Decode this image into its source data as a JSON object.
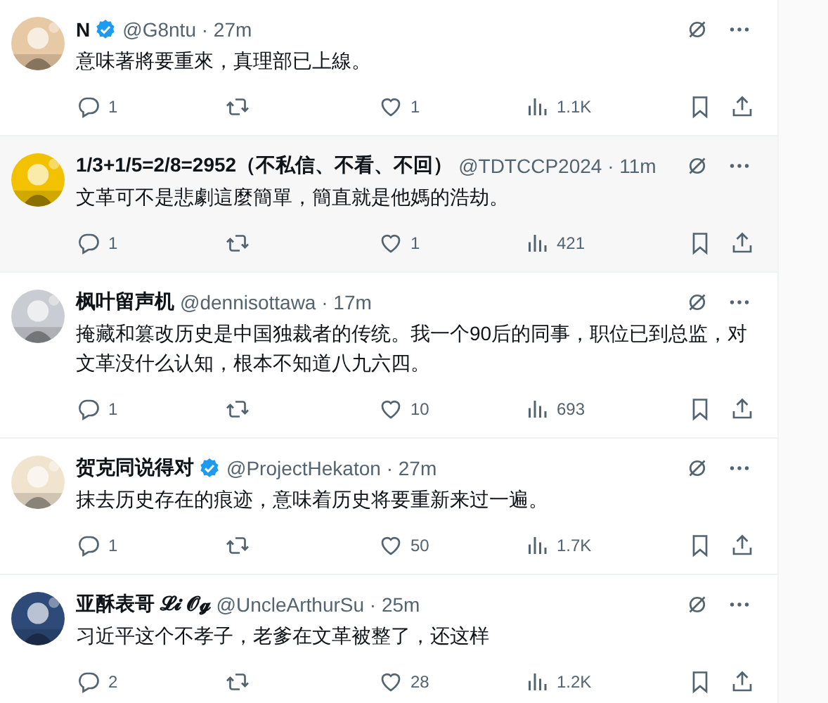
{
  "tweets": [
    {
      "name": "N",
      "verified": true,
      "meta": "@G8ntu · 27m",
      "text": "意味著將要重來，真理部已上線。",
      "highlighted": false,
      "replies": "1",
      "likes": "1",
      "views": "1.1K"
    },
    {
      "name": "1/3+1/5=2/8=2952（不私信、不看、不回）",
      "verified": false,
      "meta": "@TDTCCP2024 · 11m",
      "text": "文革可不是悲劇這麼簡單，簡直就是他媽的浩劫。",
      "highlighted": true,
      "replies": "1",
      "likes": "1",
      "views": "421"
    },
    {
      "name": "枫叶留声机",
      "verified": false,
      "meta": "@dennisottawa · 17m",
      "text": "掩藏和篡改历史是中国独裁者的传统。我一个90后的同事，职位已到总监，对文革没什么认知，根本不知道八九六四。",
      "highlighted": false,
      "replies": "1",
      "likes": "10",
      "views": "693"
    },
    {
      "name": "贺克同说得对",
      "verified": true,
      "meta": "@ProjectHekaton · 27m",
      "text": "抹去历史存在的痕迹，意味着历史将要重新来过一遍。",
      "highlighted": false,
      "replies": "1",
      "likes": "50",
      "views": "1.7K"
    },
    {
      "name": "亚酥表哥 𝓛𝓲 𝓞𝓰",
      "verified": false,
      "meta": "@UncleArthurSu · 25m",
      "text": "习近平这个不孝子，老爹在文革被整了，还这样",
      "highlighted": false,
      "replies": "2",
      "likes": "28",
      "views": "1.2K"
    }
  ]
}
